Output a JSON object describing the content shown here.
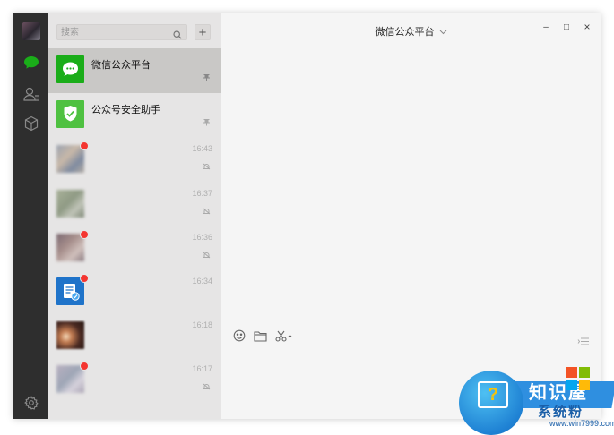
{
  "search": {
    "placeholder": "搜索"
  },
  "add_button": "+",
  "chats": [
    {
      "name": "微信公众平台",
      "time": "",
      "active": true,
      "pinned": true
    },
    {
      "name": "公众号安全助手",
      "time": "",
      "active": false,
      "pinned": true
    },
    {
      "name": "",
      "time": "16:43",
      "unread": true,
      "muted": true
    },
    {
      "name": "",
      "time": "16:37",
      "unread": false,
      "muted": true
    },
    {
      "name": "",
      "time": "16:36",
      "unread": true,
      "muted": true
    },
    {
      "name": "",
      "time": "16:34",
      "unread": true,
      "muted": false
    },
    {
      "name": "",
      "time": "16:18",
      "unread": false,
      "muted": false
    },
    {
      "name": "",
      "time": "16:17",
      "unread": true,
      "muted": true
    }
  ],
  "chat_header": {
    "title": "微信公众平台"
  },
  "window_controls": {
    "minimize": "–",
    "maximize": "□",
    "close": "×"
  },
  "watermark": {
    "brand": "知识屋",
    "site": "系统粉",
    "url": "www.win7999.com"
  },
  "colors": {
    "nav_bg": "#2e2e2e",
    "accent_green": "#1aad19",
    "unread_red": "#f43530"
  }
}
